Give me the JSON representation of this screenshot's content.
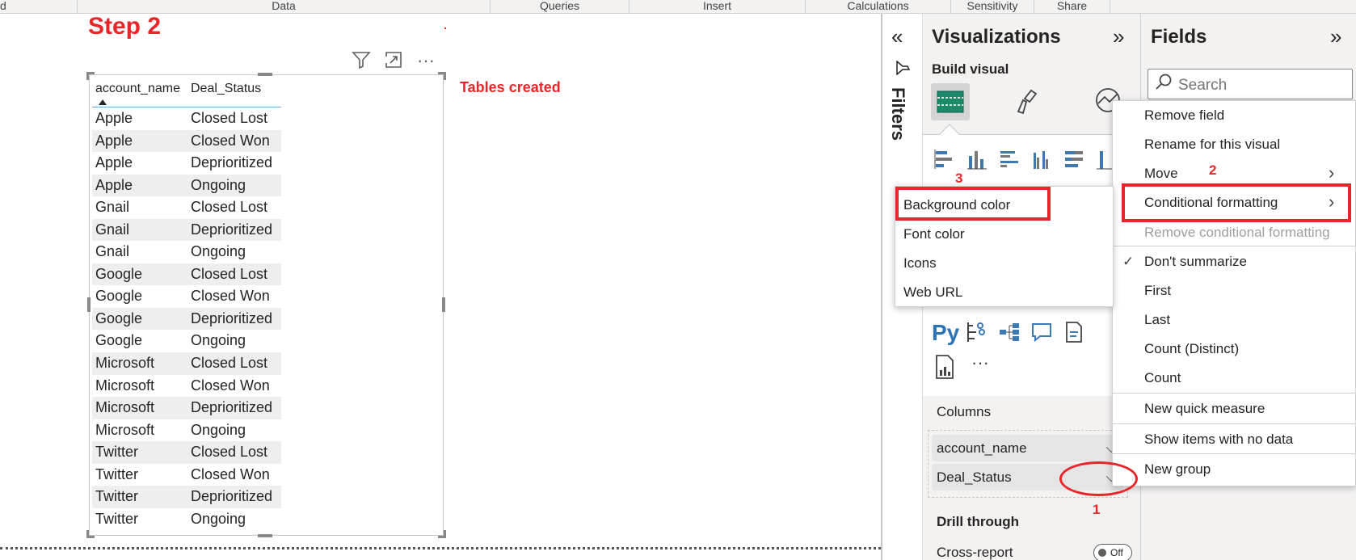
{
  "ribbon": {
    "groups": [
      "d",
      "Data",
      "Queries",
      "Insert",
      "Calculations",
      "Sensitivity",
      "Share"
    ]
  },
  "canvas": {
    "step_title": "Step 2",
    "note": "Tables created",
    "toolbar_icons": [
      "filter-icon",
      "focus-mode-icon",
      "more-options-icon"
    ],
    "table": {
      "headers": [
        "account_name",
        "Deal_Status"
      ],
      "sorted_column": "account_name",
      "rows": [
        [
          "Apple",
          "Closed Lost"
        ],
        [
          "Apple",
          "Closed Won"
        ],
        [
          "Apple",
          "Deprioritized"
        ],
        [
          "Apple",
          "Ongoing"
        ],
        [
          "Gnail",
          "Closed Lost"
        ],
        [
          "Gnail",
          "Deprioritized"
        ],
        [
          "Gnail",
          "Ongoing"
        ],
        [
          "Google",
          "Closed Lost"
        ],
        [
          "Google",
          "Closed Won"
        ],
        [
          "Google",
          "Deprioritized"
        ],
        [
          "Google",
          "Ongoing"
        ],
        [
          "Microsoft",
          "Closed Lost"
        ],
        [
          "Microsoft",
          "Closed Won"
        ],
        [
          "Microsoft",
          "Deprioritized"
        ],
        [
          "Microsoft",
          "Ongoing"
        ],
        [
          "Twitter",
          "Closed Lost"
        ],
        [
          "Twitter",
          "Closed Won"
        ],
        [
          "Twitter",
          "Deprioritized"
        ],
        [
          "Twitter",
          "Ongoing"
        ]
      ]
    }
  },
  "filters": {
    "label": "Filters",
    "collapse_glyph": "«"
  },
  "visualizations": {
    "title": "Visualizations",
    "expand_glyph": "»",
    "build_visual": "Build visual",
    "more_glyph": "···",
    "python_label": "Py",
    "columns_label": "Columns",
    "fields": [
      "account_name",
      "Deal_Status"
    ],
    "drill_through": "Drill through",
    "cross_report": "Cross-report",
    "cross_report_toggle": "Off"
  },
  "fields_pane": {
    "title": "Fields",
    "expand_glyph": "»",
    "search_placeholder": "Search"
  },
  "context_menu": {
    "items": {
      "remove_field": "Remove field",
      "rename": "Rename for this visual",
      "move": "Move",
      "conditional_formatting": "Conditional formatting",
      "remove_conditional": "Remove conditional formatting",
      "dont_summarize": "Don't summarize",
      "first": "First",
      "last": "Last",
      "count_distinct": "Count (Distinct)",
      "count": "Count",
      "new_quick_measure": "New quick measure",
      "show_items_no_data": "Show items with no data",
      "new_group": "New group"
    },
    "checked": "Don't summarize"
  },
  "submenu": {
    "items": [
      "Background color",
      "Font color",
      "Icons",
      "Web URL"
    ]
  },
  "annotations": {
    "num1": "1",
    "num2": "2",
    "num3": "3",
    "color": "#e8262a"
  }
}
